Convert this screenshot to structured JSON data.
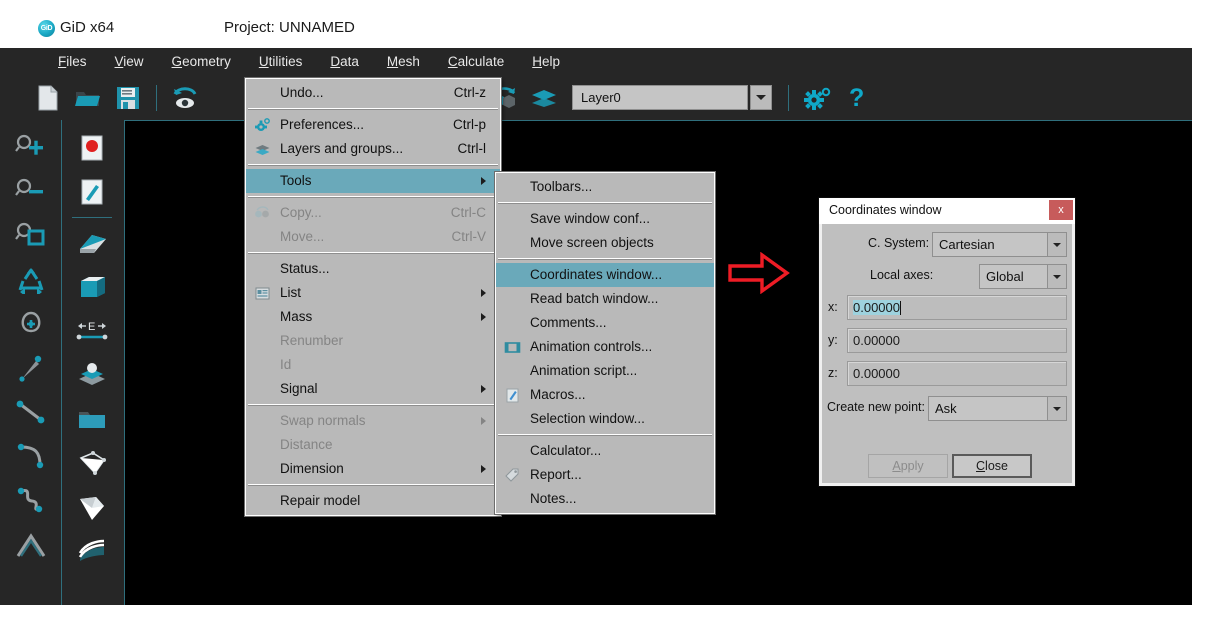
{
  "app": {
    "logo_text": "GiD",
    "name": "GiD x64",
    "project": "Project: UNNAMED"
  },
  "menubar": [
    {
      "label": "Files",
      "mnemonic": "F"
    },
    {
      "label": "View",
      "mnemonic": "V"
    },
    {
      "label": "Geometry",
      "mnemonic": "G"
    },
    {
      "label": "Utilities",
      "mnemonic": "U"
    },
    {
      "label": "Data",
      "mnemonic": "D"
    },
    {
      "label": "Mesh",
      "mnemonic": "M"
    },
    {
      "label": "Calculate",
      "mnemonic": "C"
    },
    {
      "label": "Help",
      "mnemonic": "H"
    }
  ],
  "toolbar_top": {
    "icons": [
      "new-file-icon",
      "open-folder-icon",
      "save-disk-icon",
      "undo-eye-icon"
    ],
    "icons_right": [
      "rotate-cube-icon",
      "layers-icon"
    ],
    "layer_value": "Layer0",
    "layer_placeholder": "Layer0",
    "settings_icon": "gear-degree-icon",
    "help_icon": "question-mark-icon"
  },
  "toolbar_left": {
    "col1": [
      "zoom-in-icon",
      "zoom-out-icon",
      "zoom-window-icon",
      "redraw-icon",
      "rotate-icon",
      "create-point-icon",
      "create-line-icon",
      "create-arc-icon",
      "create-nurbs-line-icon",
      "create-polyline-icon"
    ],
    "col2": [
      "point-red-icon",
      "edit-pencil-icon",
      "nurbs-surface-icon",
      "volume-icon",
      "dimension-icon",
      "contour-surface-icon",
      "open-folder-blue-icon",
      "mesh-view-icon",
      "mesh-solid-icon",
      "results-icon"
    ]
  },
  "menu_utilities": {
    "name": "Utilities",
    "items": [
      {
        "label": "Undo...",
        "accel": "Ctrl-z",
        "icon": null,
        "state": "normal",
        "submenu": false
      },
      {
        "type": "separator"
      },
      {
        "label": "Preferences...",
        "accel": "Ctrl-p",
        "icon": "preferences-gear-icon",
        "state": "normal",
        "submenu": false
      },
      {
        "label": "Layers and groups...",
        "accel": "Ctrl-l",
        "icon": "layers-icon",
        "state": "normal",
        "submenu": false
      },
      {
        "type": "separator"
      },
      {
        "label": "Tools",
        "accel": "",
        "icon": null,
        "state": "highlighted",
        "submenu": true
      },
      {
        "type": "separator"
      },
      {
        "label": "Copy...",
        "accel": "Ctrl-C",
        "icon": "copy-icon",
        "state": "disabled",
        "submenu": false
      },
      {
        "label": "Move...",
        "accel": "Ctrl-V",
        "icon": null,
        "state": "disabled",
        "submenu": false
      },
      {
        "type": "separator"
      },
      {
        "label": "Status...",
        "accel": "",
        "icon": null,
        "state": "normal",
        "submenu": false
      },
      {
        "label": "List",
        "accel": "",
        "icon": "list-icon",
        "state": "normal",
        "submenu": true
      },
      {
        "label": "Mass",
        "accel": "",
        "icon": null,
        "state": "normal",
        "submenu": true
      },
      {
        "label": "Renumber",
        "accel": "",
        "icon": null,
        "state": "disabled",
        "submenu": false
      },
      {
        "label": "Id",
        "accel": "",
        "icon": null,
        "state": "disabled",
        "submenu": false
      },
      {
        "label": "Signal",
        "accel": "",
        "icon": null,
        "state": "normal",
        "submenu": true
      },
      {
        "type": "separator"
      },
      {
        "label": "Swap normals",
        "accel": "",
        "icon": null,
        "state": "disabled",
        "submenu": true
      },
      {
        "label": "Distance",
        "accel": "",
        "icon": null,
        "state": "disabled",
        "submenu": false
      },
      {
        "label": "Dimension",
        "accel": "",
        "icon": null,
        "state": "normal",
        "submenu": true
      },
      {
        "type": "separator"
      },
      {
        "label": "Repair model",
        "accel": "",
        "icon": null,
        "state": "normal",
        "submenu": false
      }
    ]
  },
  "menu_tools": {
    "name": "Tools",
    "items": [
      {
        "label": "Toolbars...",
        "icon": null,
        "state": "normal"
      },
      {
        "type": "separator"
      },
      {
        "label": "Save window conf...",
        "icon": null,
        "state": "normal"
      },
      {
        "label": "Move screen objects",
        "icon": null,
        "state": "normal"
      },
      {
        "type": "separator"
      },
      {
        "label": "Coordinates window...",
        "icon": null,
        "state": "highlighted"
      },
      {
        "label": "Read batch window...",
        "icon": null,
        "state": "normal"
      },
      {
        "label": "Comments...",
        "icon": null,
        "state": "normal"
      },
      {
        "label": "Animation controls...",
        "icon": "film-frame-icon",
        "state": "normal"
      },
      {
        "label": "Animation script...",
        "icon": null,
        "state": "normal"
      },
      {
        "label": "Macros...",
        "icon": "macro-pencil-icon",
        "state": "normal"
      },
      {
        "label": "Selection window...",
        "icon": null,
        "state": "normal"
      },
      {
        "type": "separator"
      },
      {
        "label": "Calculator...",
        "icon": null,
        "state": "normal"
      },
      {
        "label": "Report...",
        "icon": "report-tag-icon",
        "state": "normal"
      },
      {
        "label": "Notes...",
        "icon": null,
        "state": "normal"
      }
    ]
  },
  "annotation": {
    "arrow": "red-right-arrow",
    "color": "#ee1c25"
  },
  "dialog": {
    "title": "Coordinates window",
    "close_label": "x",
    "close_color": "#c75b5b",
    "csystem_label": "C. System:",
    "csystem_value": "Cartesian",
    "localaxes_label": "Local axes:",
    "localaxes_value": "Global",
    "x_label": "x:",
    "x_value": "0.00000",
    "y_label": "y:",
    "y_value": "0.00000",
    "z_label": "z:",
    "z_value": "0.00000",
    "createpoint_label": "Create new point:",
    "createpoint_value": "Ask",
    "apply_label": "Apply",
    "apply_mnemonic": "A",
    "close_button_label": "Close",
    "close_button_mnemonic": "C"
  },
  "colors": {
    "chrome_dark": "#262626",
    "accent_teal": "#2f6f7d",
    "menu_bg": "#b9b9b9",
    "menu_highlight": "#6aa9ba",
    "canvas": "#000000",
    "field_selection": "#9ed2de"
  }
}
